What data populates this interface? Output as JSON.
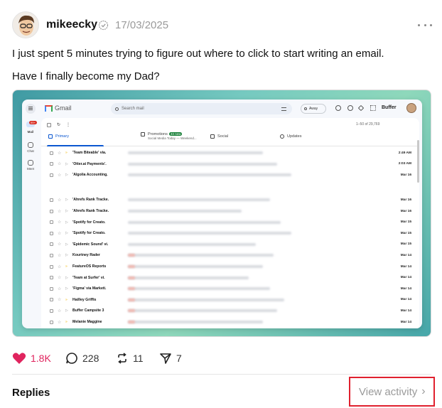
{
  "post": {
    "author": "mikeecky",
    "timestamp": "17/03/2025",
    "text_line1": "I just spent 5 minutes trying to figure out where to click to start writing an email.",
    "text_line2": "Have I finally become my Dad?"
  },
  "screenshot": {
    "app_name": "Gmail",
    "search_placeholder": "Search mail",
    "status": "Away",
    "brand": "Buffer",
    "rail": [
      {
        "label": "Mail",
        "badge": "99+",
        "icon": "mail-icon"
      },
      {
        "label": "Chat",
        "icon": "chat-icon"
      },
      {
        "label": "Meet",
        "icon": "video-icon"
      }
    ],
    "count": "1–50 of 29,769",
    "tabs": [
      {
        "label": "Primary",
        "icon": "inbox-icon"
      },
      {
        "label": "Promotions",
        "badge": "33 new",
        "sub": "Social Media Today — Weekend...",
        "icon": "tag-icon"
      },
      {
        "label": "Social",
        "icon": "people-icon"
      },
      {
        "label": "Updates",
        "icon": "info-icon"
      }
    ],
    "rows": [
      {
        "sender": "'Team Biteable' via.",
        "date": "2:49 AM",
        "important": true
      },
      {
        "sender": "'Otter.ai Payments'.",
        "date": "2:03 AM",
        "important": false
      },
      {
        "sender": "'Algolia Accounting.",
        "date": "Mar 16",
        "important": false
      },
      {
        "sender": "",
        "date": "Mar 16",
        "important": false
      },
      {
        "sender": "'Ahrefs Rank Tracke.",
        "date": "Mar 16",
        "important": false
      },
      {
        "sender": "'Ahrefs Rank Tracke.",
        "date": "Mar 16",
        "important": false
      },
      {
        "sender": "'Spotify for Creato.",
        "date": "Mar 15",
        "important": false
      },
      {
        "sender": "'Spotify for Creato.",
        "date": "Mar 15",
        "important": false
      },
      {
        "sender": "'Epidemic Sound' vi.",
        "date": "Mar 15",
        "important": false
      },
      {
        "sender": "Kourtney Rader",
        "date": "Mar 14",
        "important": false
      },
      {
        "sender": "FeatureOS Reports",
        "date": "Mar 14",
        "important": true
      },
      {
        "sender": "'Team at Surfer' vi.",
        "date": "Mar 14",
        "important": false
      },
      {
        "sender": "'Figma' via Marketi.",
        "date": "Mar 14",
        "important": false
      },
      {
        "sender": "Hailley Griffis",
        "date": "Mar 14",
        "important": true
      },
      {
        "sender": "Buffer Campsite 3",
        "date": "Mar 14",
        "important": false
      },
      {
        "sender": "Melanie Maggine",
        "date": "Mar 14",
        "important": true
      }
    ]
  },
  "actions": {
    "likes": "1.8K",
    "replies": "228",
    "reposts": "11",
    "shares": "7",
    "like_color": "#e0245e"
  },
  "footer": {
    "replies_label": "Replies",
    "view_activity": "View activity"
  }
}
